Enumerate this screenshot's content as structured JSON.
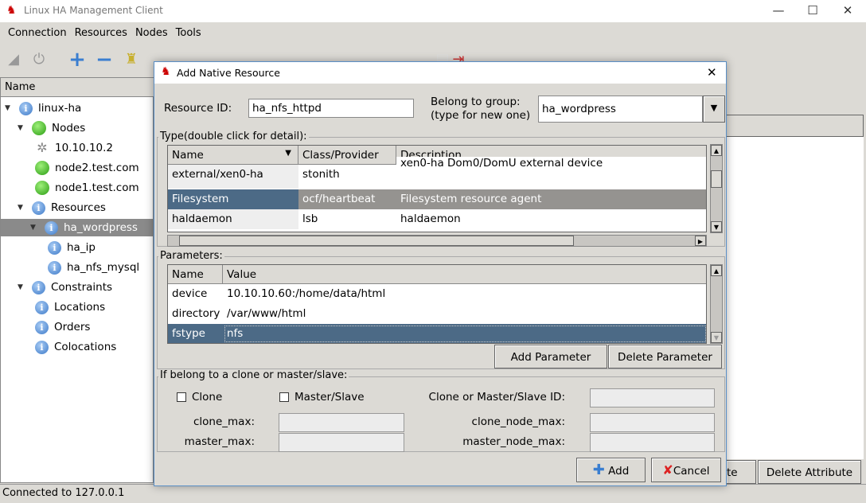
{
  "window": {
    "title": "Linux HA Management Client",
    "minimize": "—",
    "maximize": "☐",
    "close": "✕"
  },
  "menu": [
    "Connection",
    "Resources",
    "Nodes",
    "Tools"
  ],
  "tree": {
    "header": "Name",
    "items": [
      {
        "label": "linux-ha",
        "icon": "info"
      },
      {
        "label": "Nodes",
        "icon": "green"
      },
      {
        "label": "10.10.10.2",
        "icon": "tools"
      },
      {
        "label": "node2.test.com",
        "icon": "green"
      },
      {
        "label": "node1.test.com",
        "icon": "green"
      },
      {
        "label": "Resources",
        "icon": "info"
      },
      {
        "label": "ha_wordpress",
        "icon": "info"
      },
      {
        "label": "ha_ip",
        "icon": "info"
      },
      {
        "label": "ha_nfs_mysql",
        "icon": "info"
      },
      {
        "label": "Constraints",
        "icon": "info"
      },
      {
        "label": "Locations",
        "icon": "info"
      },
      {
        "label": "Orders",
        "icon": "info"
      },
      {
        "label": "Colocations",
        "icon": "info"
      }
    ]
  },
  "right": {
    "btn_partial": "te",
    "delete_attribute": "Delete Attribute"
  },
  "status": "Connected to 127.0.0.1",
  "dialog": {
    "title": "Add Native Resource",
    "resource_id_label": "Resource ID:",
    "resource_id": "ha_nfs_httpd",
    "group_label1": "Belong to group:",
    "group_label2": "(type for new one)",
    "group": "ha_wordpress",
    "type_label": "Type(double click for detail):",
    "type_columns": [
      "Name",
      "Class/Provider",
      "Description"
    ],
    "type_rows": [
      [
        "external/xen0-ha",
        "stonith",
        "xen0-ha Dom0/DomU external device"
      ],
      [
        "Filesystem",
        "ocf/heartbeat",
        "Filesystem resource agent"
      ],
      [
        "haldaemon",
        "lsb",
        "haldaemon"
      ]
    ],
    "params_label": "Parameters:",
    "param_columns": [
      "Name",
      "Value"
    ],
    "param_rows": [
      [
        "device",
        "10.10.10.60:/home/data/html"
      ],
      [
        "directory",
        "/var/www/html"
      ],
      [
        "fstype",
        "nfs"
      ]
    ],
    "add_parameter": "Add Parameter",
    "delete_parameter": "Delete Parameter",
    "clone_group_label": "If belong to a clone or master/slave:",
    "clone": "Clone",
    "master_slave": "Master/Slave",
    "clone_id_label": "Clone or Master/Slave ID:",
    "clone_max": "clone_max:",
    "clone_node_max": "clone_node_max:",
    "master_max": "master_max:",
    "master_node_max": "master_node_max:",
    "add": "Add",
    "cancel": "Cancel"
  }
}
